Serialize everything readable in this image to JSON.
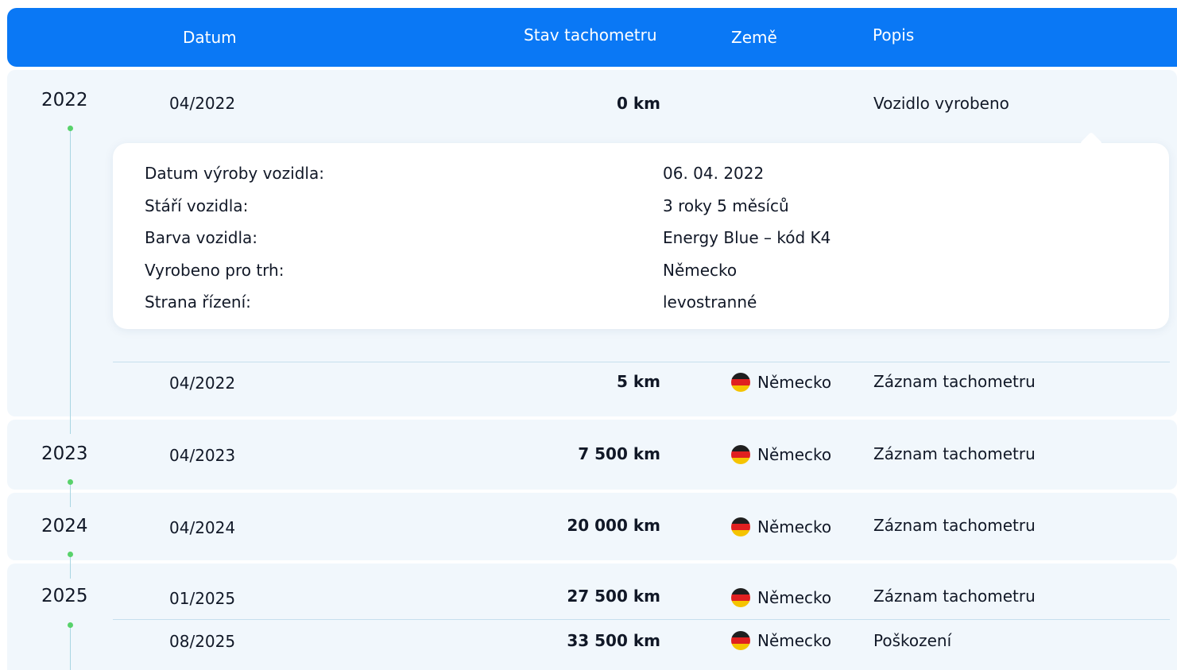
{
  "header": {
    "date_label": "Datum",
    "odometer_label": "Stav tachometru",
    "country_label": "Země",
    "description_label": "Popis"
  },
  "years": [
    "2022",
    "2023",
    "2024",
    "2025"
  ],
  "records": [
    {
      "date": "04/2022",
      "odometer": "0 km",
      "country": "",
      "description": "Vozidlo vyrobeno"
    },
    {
      "date": "04/2022",
      "odometer": "5 km",
      "country": "Německo",
      "description": "Záznam tachometru"
    },
    {
      "date": "04/2023",
      "odometer": "7 500 km",
      "country": "Německo",
      "description": "Záznam tachometru"
    },
    {
      "date": "04/2024",
      "odometer": "20 000 km",
      "country": "Německo",
      "description": "Záznam tachometru"
    },
    {
      "date": "01/2025",
      "odometer": "27 500 km",
      "country": "Německo",
      "description": "Záznam tachometru"
    },
    {
      "date": "08/2025",
      "odometer": "33 500 km",
      "country": "Německo",
      "description": "Poškození"
    }
  ],
  "details": [
    {
      "label": "Datum výroby vozidla:",
      "value": "06. 04. 2022"
    },
    {
      "label": "Stáří vozidla:",
      "value": "3 roky 5 měsíců"
    },
    {
      "label": "Barva vozidla:",
      "value": "Energy Blue – kód K4"
    },
    {
      "label": "Vyrobeno pro trh:",
      "value": "Německo"
    },
    {
      "label": "Strana řízení:",
      "value": "levostranné"
    }
  ],
  "colors": {
    "header": "#0a78f5",
    "band": "#f1f7fc",
    "dot": "#58d26b"
  },
  "icons": {
    "flag": "german-flag-icon"
  }
}
